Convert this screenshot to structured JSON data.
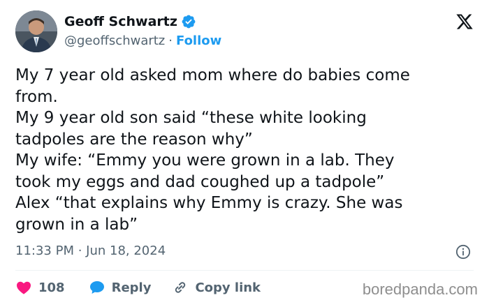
{
  "author": {
    "name": "Geoff Schwartz",
    "handle": "@geoffschwartz",
    "separator": "·",
    "follow_label": "Follow"
  },
  "tweet": {
    "text": "My 7 year old asked mom where do babies come\nfrom.\nMy 9 year old son said “these white looking\ntadpoles are the reason why”\nMy wife: “Emmy you were grown in a lab. They\ntook my eggs and dad coughed up a tadpole”\nAlex “that explains why Emmy is crazy. She was\ngrown in a lab”",
    "timestamp": "11:33 PM · Jun 18, 2024"
  },
  "actions": {
    "like_count": "108",
    "reply_label": "Reply",
    "copy_label": "Copy link"
  },
  "watermark": "boredpanda.com",
  "colors": {
    "accent": "#1d9bf0",
    "like": "#f91880",
    "text": "#0f1419",
    "muted": "#536471"
  }
}
